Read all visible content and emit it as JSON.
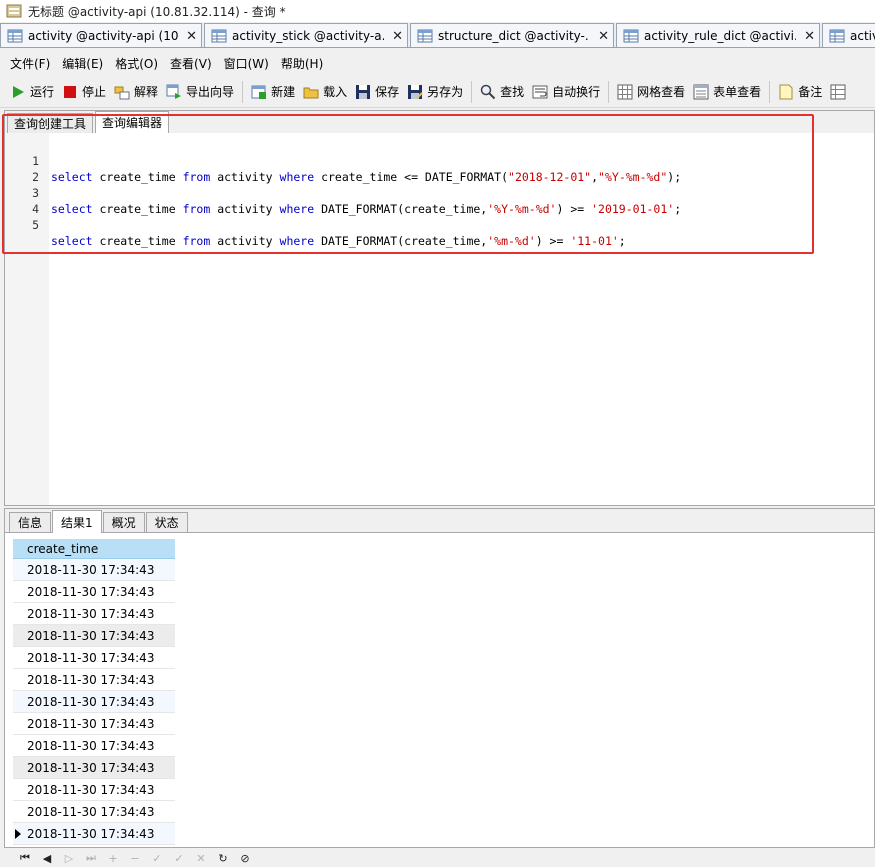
{
  "window": {
    "title": "无标题 @activity-api (10.81.32.114) - 查询 *"
  },
  "doc_tabs": [
    {
      "label": "activity @activity-api (10..."
    },
    {
      "label": "activity_stick @activity-a..."
    },
    {
      "label": "structure_dict @activity-..."
    },
    {
      "label": "activity_rule_dict @activi..."
    },
    {
      "label": "activ"
    }
  ],
  "menu": [
    "文件(F)",
    "编辑(E)",
    "格式(O)",
    "查看(V)",
    "窗口(W)",
    "帮助(H)"
  ],
  "toolbar": {
    "run": "运行",
    "stop": "停止",
    "explain": "解释",
    "export": "导出向导",
    "new": "新建",
    "load": "载入",
    "save": "保存",
    "save_as": "另存为",
    "find": "查找",
    "wrap": "自动换行",
    "grid_view": "网格查看",
    "form_view": "表单查看",
    "note": "备注"
  },
  "editor_tabs": [
    "查询创建工具",
    "查询编辑器"
  ],
  "code": {
    "line_numbers": [
      "1",
      "2",
      "3",
      "4",
      "5"
    ],
    "line1": {
      "kw1": "select",
      "t1": " create_time ",
      "kw2": "from",
      "t2": " activity ",
      "kw3": "where",
      "t3": " create_time <= DATE_FORMAT(",
      "s1": "\"2018-12-01\"",
      "t4": ",",
      "s2": "\"%Y-%m-%d\"",
      "t5": ");"
    },
    "line3": {
      "kw1": "select",
      "t1": " create_time ",
      "kw2": "from",
      "t2": " activity ",
      "kw3": "where",
      "t3": " DATE_FORMAT(create_time,",
      "s1": "'%Y-%m-%d'",
      "t4": ") >= ",
      "s2": "'2019-01-01'",
      "t5": ";"
    },
    "line5": {
      "kw1": "select",
      "t1": " create_time ",
      "kw2": "from",
      "t2": " activity ",
      "kw3": "where",
      "t3": " DATE_FORMAT(create_time,",
      "s1": "'%m-%d'",
      "t4": ") >= ",
      "s2": "'11-01'",
      "t5": ";"
    }
  },
  "result_tabs": [
    "信息",
    "结果1",
    "概况",
    "状态"
  ],
  "result_grid": {
    "column": "create_time",
    "rows": [
      "2018-11-30 17:34:43",
      "2018-11-30 17:34:43",
      "2018-11-30 17:34:43",
      "2018-11-30 17:34:43",
      "2018-11-30 17:34:43",
      "2018-11-30 17:34:43",
      "2018-11-30 17:34:43",
      "2018-11-30 17:34:43",
      "2018-11-30 17:34:43",
      "2018-11-30 17:34:43",
      "2018-11-30 17:34:43",
      "2018-11-30 17:34:43",
      "2018-11-30 17:34:43"
    ]
  },
  "navigator": {
    "first": "⏮",
    "prev": "◀",
    "next": "▷",
    "last": "⏭",
    "add": "+",
    "delete": "−",
    "post": "✓",
    "confirm": "✓",
    "cancel": "✕",
    "refresh": "↻",
    "stop": "⊘"
  }
}
